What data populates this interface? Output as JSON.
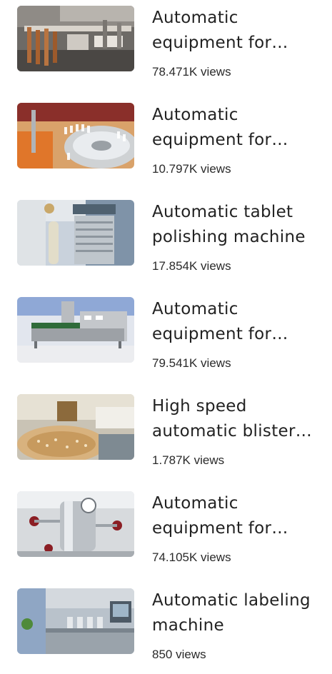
{
  "videos": [
    {
      "title": "Automatic equipment for bottling",
      "views": "78.471K views",
      "thumbnail": "machine-gripper-line"
    },
    {
      "title": "Automatic equipment for bottles",
      "views": "10.797K views",
      "thumbnail": "bottle-unscrambler"
    },
    {
      "title": "Automatic tablet polishing machine",
      "views": "17.854K views",
      "thumbnail": "tablet-polisher"
    },
    {
      "title": "Automatic equipment for sealing",
      "views": "79.541K views",
      "thumbnail": "induction-sealer"
    },
    {
      "title": "High speed automatic blister packing",
      "views": "1.787K views",
      "thumbnail": "capsule-feeder"
    },
    {
      "title": "Automatic equipment for mixing",
      "views": "74.105K views",
      "thumbnail": "steel-tank-valves"
    },
    {
      "title": "Automatic labeling machine",
      "views": "850 views",
      "thumbnail": "labeling-line"
    }
  ]
}
